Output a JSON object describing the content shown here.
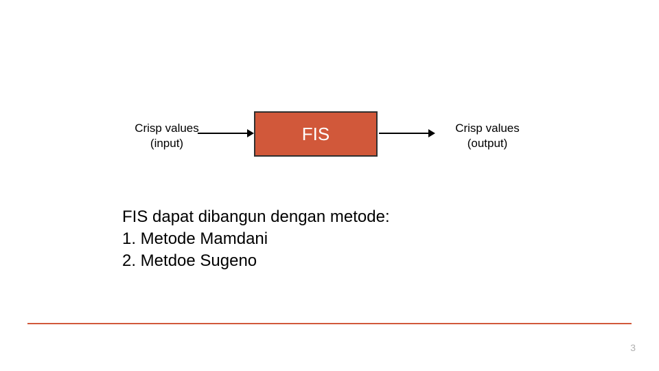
{
  "diagram": {
    "input_label_line1": "Crisp values",
    "input_label_line2": "(input)",
    "fis_box_label": "FIS",
    "output_label_line1": "Crisp values",
    "output_label_line2": "(output)"
  },
  "body": {
    "intro": "FIS dapat dibangun dengan metode:",
    "item1": "1. Metode Mamdani",
    "item2": "2. Metdoe Sugeno"
  },
  "page_number": "3",
  "colors": {
    "accent": "#d1583a"
  }
}
